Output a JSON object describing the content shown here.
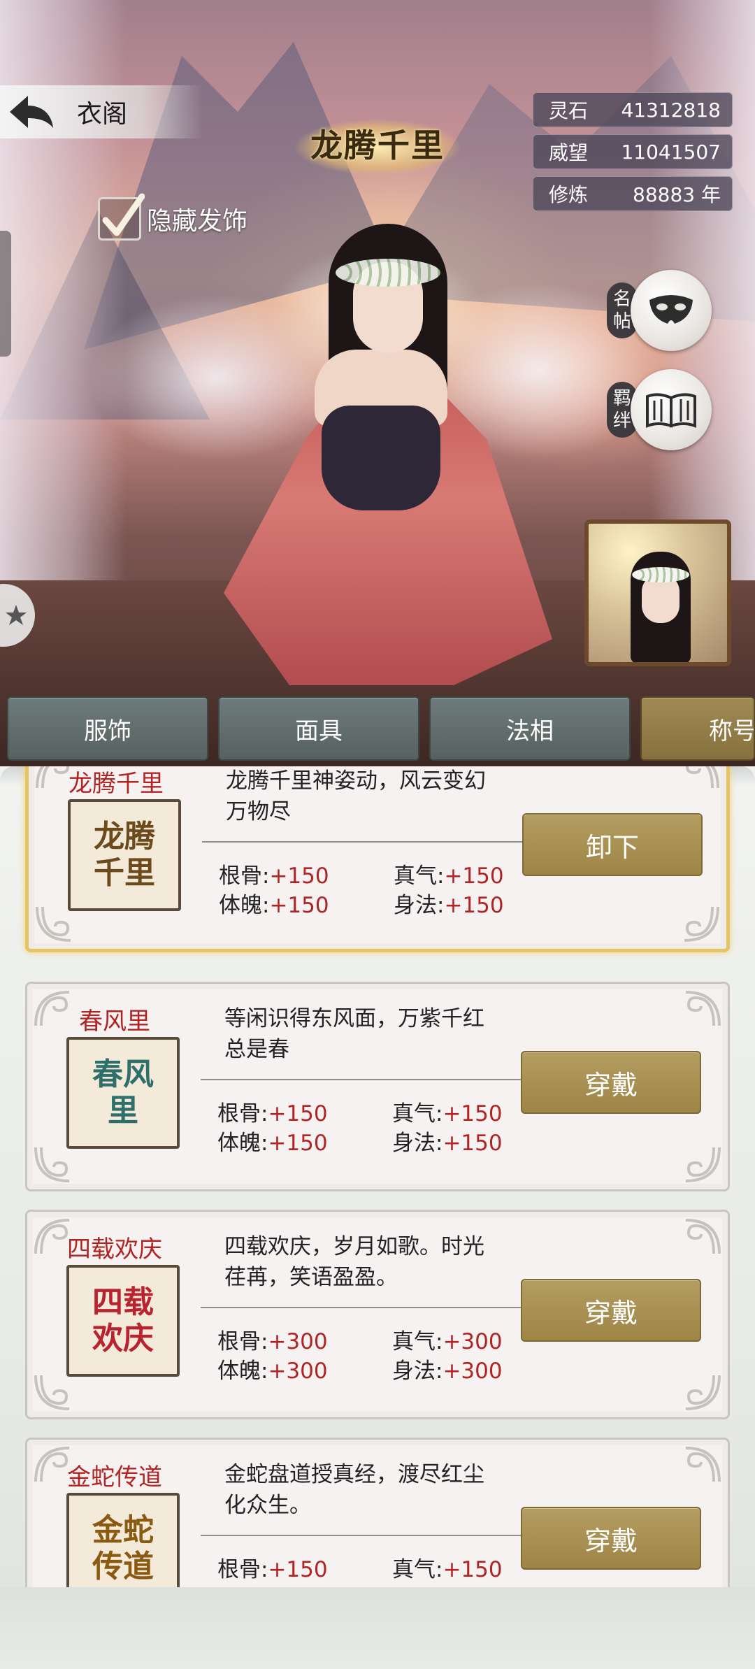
{
  "header": {
    "back_title": "衣阁",
    "emblem_title": "龙腾千里"
  },
  "stats": [
    {
      "label": "灵石",
      "value": "41312818"
    },
    {
      "label": "威望",
      "value": "11041507"
    },
    {
      "label": "修炼",
      "value": "88883 年"
    }
  ],
  "hide_toggle": {
    "label": "隐藏发饰",
    "checked": true
  },
  "side_buttons": {
    "card_label": "名帖",
    "bond_label": "羁绊"
  },
  "tabs": [
    {
      "label": "服饰"
    },
    {
      "label": "面具"
    },
    {
      "label": "法相"
    },
    {
      "label": "称号"
    }
  ],
  "titles": [
    {
      "name": "龙腾千里",
      "badge": "龙腾千里",
      "badge_color": "#6b4a1c",
      "description": "龙腾千里神姿动，风云变幻万物尽",
      "attrs": [
        {
          "label": "根骨:",
          "value": "+150"
        },
        {
          "label": "真气:",
          "value": "+150"
        },
        {
          "label": "体魄:",
          "value": "+150"
        },
        {
          "label": "身法:",
          "value": "+150"
        }
      ],
      "action": "卸下",
      "equipped": true
    },
    {
      "name": "春风里",
      "badge": "春风里",
      "badge_color": "#2f6f6a",
      "description": "等闲识得东风面，万紫千红总是春",
      "attrs": [
        {
          "label": "根骨:",
          "value": "+150"
        },
        {
          "label": "真气:",
          "value": "+150"
        },
        {
          "label": "体魄:",
          "value": "+150"
        },
        {
          "label": "身法:",
          "value": "+150"
        }
      ],
      "action": "穿戴",
      "equipped": false
    },
    {
      "name": "四载欢庆",
      "badge": "四载欢庆",
      "badge_color": "#b8232f",
      "description": "四载欢庆，岁月如歌。时光荏苒，笑语盈盈。",
      "attrs": [
        {
          "label": "根骨:",
          "value": "+300"
        },
        {
          "label": "真气:",
          "value": "+300"
        },
        {
          "label": "体魄:",
          "value": "+300"
        },
        {
          "label": "身法:",
          "value": "+300"
        }
      ],
      "action": "穿戴",
      "equipped": false
    },
    {
      "name": "金蛇传道",
      "badge": "金蛇传道",
      "badge_color": "#8a5a12",
      "description": "金蛇盘道授真经，渡尽红尘化众生。",
      "attrs": [
        {
          "label": "根骨:",
          "value": "+150"
        },
        {
          "label": "真气:",
          "value": "+150"
        }
      ],
      "action": "穿戴",
      "equipped": false
    }
  ],
  "icons": {
    "back": "back-arrow-icon",
    "check": "checkmark-icon",
    "mask": "mask-icon",
    "book": "book-icon",
    "collapse": "star-icon"
  }
}
